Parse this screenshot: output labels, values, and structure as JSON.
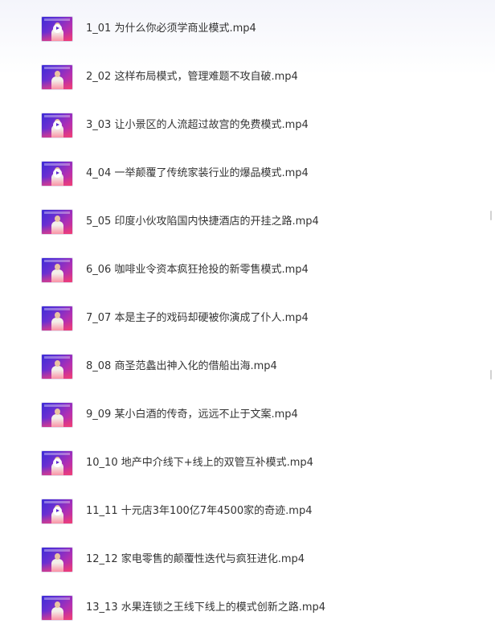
{
  "files": [
    {
      "name": "1_01 为什么你必须学商业模式.mp4",
      "thumbnail_icon": "video-thumbnail",
      "play_overlay": true
    },
    {
      "name": "2_02 这样布局模式，管理难题不攻自破.mp4",
      "thumbnail_icon": "video-thumbnail",
      "play_overlay": false
    },
    {
      "name": "3_03 让小景区的人流超过故宫的免费模式.mp4",
      "thumbnail_icon": "video-thumbnail",
      "play_overlay": true
    },
    {
      "name": "4_04 一举颠覆了传统家装行业的爆品模式.mp4",
      "thumbnail_icon": "video-thumbnail",
      "play_overlay": true
    },
    {
      "name": "5_05 印度小伙攻陷国内快捷酒店的开挂之路.mp4",
      "thumbnail_icon": "video-thumbnail",
      "play_overlay": false
    },
    {
      "name": "6_06 咖啡业令资本疯狂抢投的新零售模式.mp4",
      "thumbnail_icon": "video-thumbnail",
      "play_overlay": false
    },
    {
      "name": "7_07 本是主子的戏码却硬被你演成了仆人.mp4",
      "thumbnail_icon": "video-thumbnail",
      "play_overlay": false
    },
    {
      "name": "8_08 商圣范蠡出神入化的借船出海.mp4",
      "thumbnail_icon": "video-thumbnail",
      "play_overlay": false
    },
    {
      "name": "9_09 某小白酒的传奇，远远不止于文案.mp4",
      "thumbnail_icon": "video-thumbnail",
      "play_overlay": false
    },
    {
      "name": "10_10 地产中介线下+线上的双管互补模式.mp4",
      "thumbnail_icon": "video-thumbnail",
      "play_overlay": true
    },
    {
      "name": "11_11 十元店3年100亿7年4500家的奇迹.mp4",
      "thumbnail_icon": "video-thumbnail",
      "play_overlay": true
    },
    {
      "name": "12_12 家电零售的颠覆性迭代与疯狂进化.mp4",
      "thumbnail_icon": "video-thumbnail",
      "play_overlay": false
    },
    {
      "name": "13_13 水果连锁之王线下线上的模式创新之路.mp4",
      "thumbnail_icon": "video-thumbnail",
      "play_overlay": false
    }
  ],
  "colors": {
    "thumbnail_gradient_start": "#3b2bd6",
    "thumbnail_gradient_end": "#e0357e",
    "text": "#333333"
  }
}
